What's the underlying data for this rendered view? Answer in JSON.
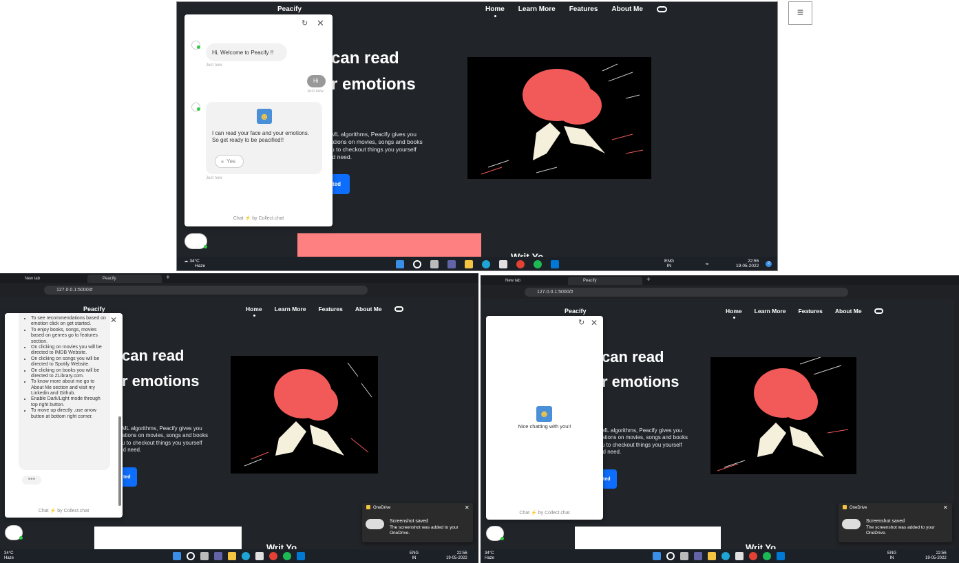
{
  "brand": "Peacify",
  "nav": {
    "home": "Home",
    "learn": "Learn More",
    "features": "Features",
    "about": "About Me"
  },
  "hero": {
    "line1": "can read",
    "line2": "r emotions",
    "desc1": "ML algorithms, Peacify gives you",
    "desc2": "ations on movies, songs and books",
    "desc3": "u to checkout things you yourself",
    "desc4": "'d need.",
    "cta": "ted",
    "next_heading": "Writ Yo..."
  },
  "chat_top": {
    "welcome": "Hi, Welcome to Peacify !!",
    "just_now": "Just now",
    "user_msg": "Hi",
    "bot_msg": "I can read your face and your emotions. So get ready to be peacified!!",
    "yes_option": "Yes",
    "footer_prefix": "Chat",
    "footer_suffix": "by Collect.chat"
  },
  "chat_left": {
    "items": [
      "To see recommendations based on emotion click on get started.",
      "To enjoy books, songs, movies based on genres go to features section.",
      "On clicking on movies you will be directed to IMDB Website.",
      "On clicking on songs you will be directed to Spotify Website.",
      "On clicking on books you will be directed to ZLibrary.com.",
      "To know more about me go to About Me section and visit my Linkedin and Github.",
      "Enable Dark/Light mode through top right button.",
      "To move up directly ,use arrow button at bottom right corner."
    ],
    "footer_prefix": "Chat",
    "footer_suffix": "by Collect.chat"
  },
  "chat_right": {
    "message": "Nice chatting with you!!",
    "footer_prefix": "Chat",
    "footer_suffix": "by Collect.chat"
  },
  "browser": {
    "tab1": "New tab",
    "tab2": "Peacify",
    "url": "127.0.0.1:5000/#"
  },
  "toast": {
    "app": "OneDrive",
    "title": "Screenshot saved",
    "body": "The screenshot was added to your OneDrive."
  },
  "taskbar_top": {
    "temp": "34°C",
    "weather": "Haze",
    "lang1": "ENG",
    "lang2": "IN",
    "time": "22:55",
    "date": "19-05-2022",
    "badge": "2"
  },
  "taskbar_bl": {
    "temp": "34°C",
    "weather": "Haze",
    "lang1": "ENG",
    "lang2": "IN",
    "time": "22:56",
    "date": "19-05-2022"
  },
  "taskbar_br": {
    "temp": "34°C",
    "weather": "Haze",
    "lang1": "ENG",
    "lang2": "IN",
    "time": "22:56",
    "date": "19-05-2022"
  },
  "colors": {
    "site_bg": "#212529",
    "cta": "#0d6efd",
    "brain": "#f25a5a",
    "pink_card": "#ff8080",
    "taskbar": "#1c2128"
  }
}
